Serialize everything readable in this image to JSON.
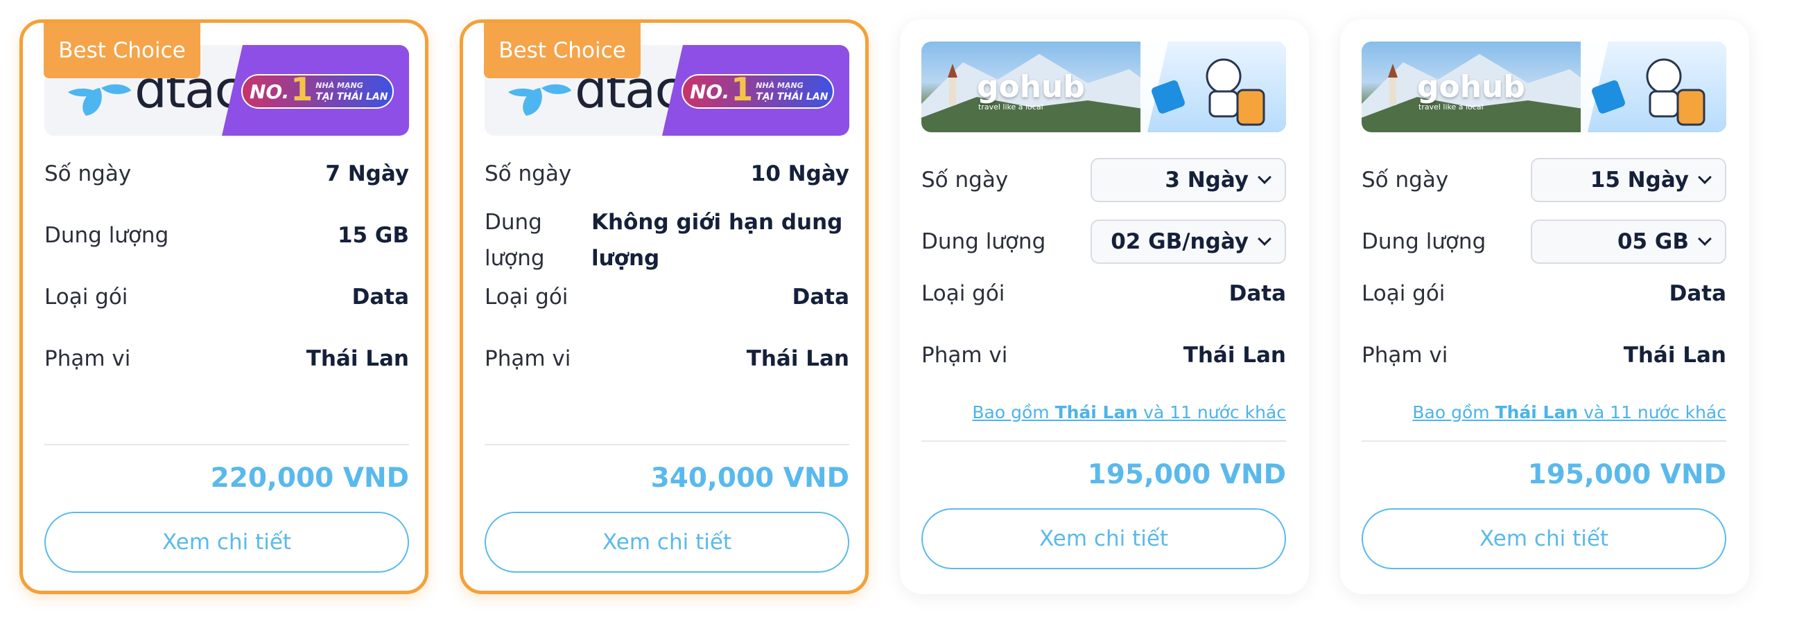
{
  "cards": [
    {
      "badge": "Best Choice",
      "brand": "dtac",
      "ribbon_no": "NO.",
      "ribbon_num": "1",
      "ribbon_small1": "NHÀ MẠNG",
      "ribbon_small2": "TẠI THÁI LAN",
      "days_label": "Số ngày",
      "days_value": "7 Ngày",
      "data_label": "Dung lượng",
      "data_value": "15 GB",
      "type_label": "Loại gói",
      "type_value": "Data",
      "scope_label": "Phạm vi",
      "scope_value": "Thái Lan",
      "price": "220,000 VND",
      "button": "Xem chi tiết"
    },
    {
      "badge": "Best Choice",
      "brand": "dtac",
      "ribbon_no": "NO.",
      "ribbon_num": "1",
      "ribbon_small1": "NHÀ MẠNG",
      "ribbon_small2": "TẠI THÁI LAN",
      "days_label": "Số ngày",
      "days_value": "10 Ngày",
      "data_label_1": "Dung",
      "data_label_2": "lượng",
      "data_value_1": "Không giới hạn dung",
      "data_value_2": "lượng",
      "type_label": "Loại gói",
      "type_value": "Data",
      "scope_label": "Phạm vi",
      "scope_value": "Thái Lan",
      "price": "340,000 VND",
      "button": "Xem chi tiết"
    },
    {
      "brand": "gohub",
      "brand_sub": "travel like a local",
      "days_label": "Số ngày",
      "days_value": "3 Ngày",
      "data_label": "Dung lượng",
      "data_value": "02 GB/ngày",
      "type_label": "Loại gói",
      "type_value": "Data",
      "scope_label": "Phạm vi",
      "scope_value": "Thái Lan",
      "include_pre": "Bao gồm ",
      "include_bold": "Thái Lan",
      "include_post": " và 11 nước khác",
      "price": "195,000 VND",
      "button": "Xem chi tiết"
    },
    {
      "brand": "gohub",
      "brand_sub": "travel like a local",
      "days_label": "Số ngày",
      "days_value": "15 Ngày",
      "data_label": "Dung lượng",
      "data_value": "05 GB",
      "type_label": "Loại gói",
      "type_value": "Data",
      "scope_label": "Phạm vi",
      "scope_value": "Thái Lan",
      "include_pre": "Bao gồm ",
      "include_bold": "Thái Lan",
      "include_post": " và 11 nước khác",
      "price": "195,000 VND",
      "button": "Xem chi tiết"
    }
  ],
  "colors": {
    "accent": "#5ab9ec",
    "best": "#f3a13a",
    "dtac_blue": "#4db6f0"
  }
}
